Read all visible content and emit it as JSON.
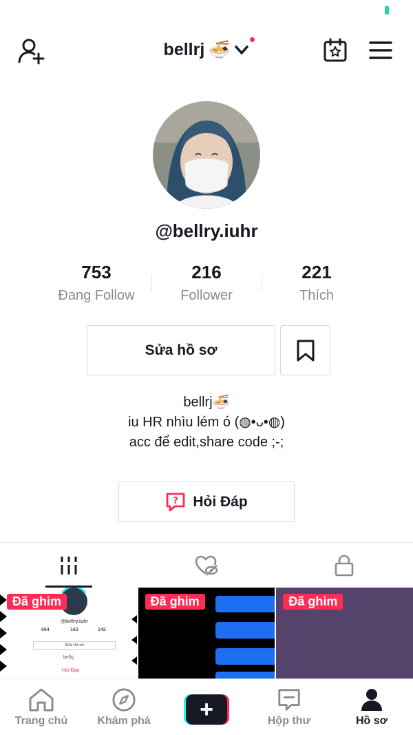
{
  "header": {
    "account_name": "bellrj",
    "account_emoji": "🍜",
    "has_notification": true
  },
  "profile": {
    "handle": "@bellry.iuhr",
    "stats": [
      {
        "value": "753",
        "label": "Đang Follow"
      },
      {
        "value": "216",
        "label": "Follower"
      },
      {
        "value": "221",
        "label": "Thích"
      }
    ],
    "edit_label": "Sửa hồ sơ",
    "bio_lines": [
      "bellrj🍜",
      "iu HR nhìu lém ó (◍•ᴗ•◍)",
      "acc để edit,share code ;-;"
    ],
    "qa_label": "Hỏi Đáp"
  },
  "tabs": [
    {
      "icon": "grid-icon",
      "active": true
    },
    {
      "icon": "liked-hidden-icon",
      "active": false
    },
    {
      "icon": "lock-icon",
      "active": false
    }
  ],
  "videos": [
    {
      "pinned_label": "Đã ghim",
      "thumb": {
        "handle": "@bellry.iuhr",
        "stats": [
          "664",
          "163",
          "142"
        ],
        "button": "Sửa hồ sơ",
        "bio": "bellrj",
        "qa": "Hỏi Đáp"
      }
    },
    {
      "pinned_label": "Đã ghim"
    },
    {
      "pinned_label": "Đã ghim"
    }
  ],
  "bottom_nav": [
    {
      "label": "Trang chủ",
      "icon": "home-icon"
    },
    {
      "label": "Khám phá",
      "icon": "compass-icon"
    },
    {
      "label": "",
      "icon": "plus-icon"
    },
    {
      "label": "Hộp thư",
      "icon": "inbox-icon"
    },
    {
      "label": "Hồ sơ",
      "icon": "profile-icon",
      "active": true
    }
  ],
  "colors": {
    "accent": "#fe2c55",
    "text": "#161823",
    "muted": "#8a8b91",
    "cyan": "#25f4ee"
  }
}
